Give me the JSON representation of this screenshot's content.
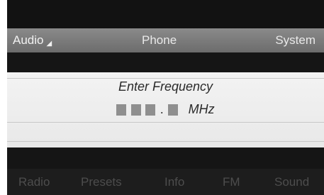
{
  "menu": {
    "audio": "Audio",
    "phone": "Phone",
    "system": "System"
  },
  "entry": {
    "prompt": "Enter Frequency",
    "unit": "MHz",
    "decimal_separator": "."
  },
  "bottom_menu": {
    "radio": "Radio",
    "presets": "Presets",
    "info": "Info",
    "fm": "FM",
    "sound": "Sound"
  },
  "colors": {
    "screen_background": "#111111",
    "menu_bar": "#7a7a7a",
    "panel": "#f0f0f0",
    "placeholder_box": "#8f8f8f",
    "inactive_text": "#4d4d4d"
  }
}
